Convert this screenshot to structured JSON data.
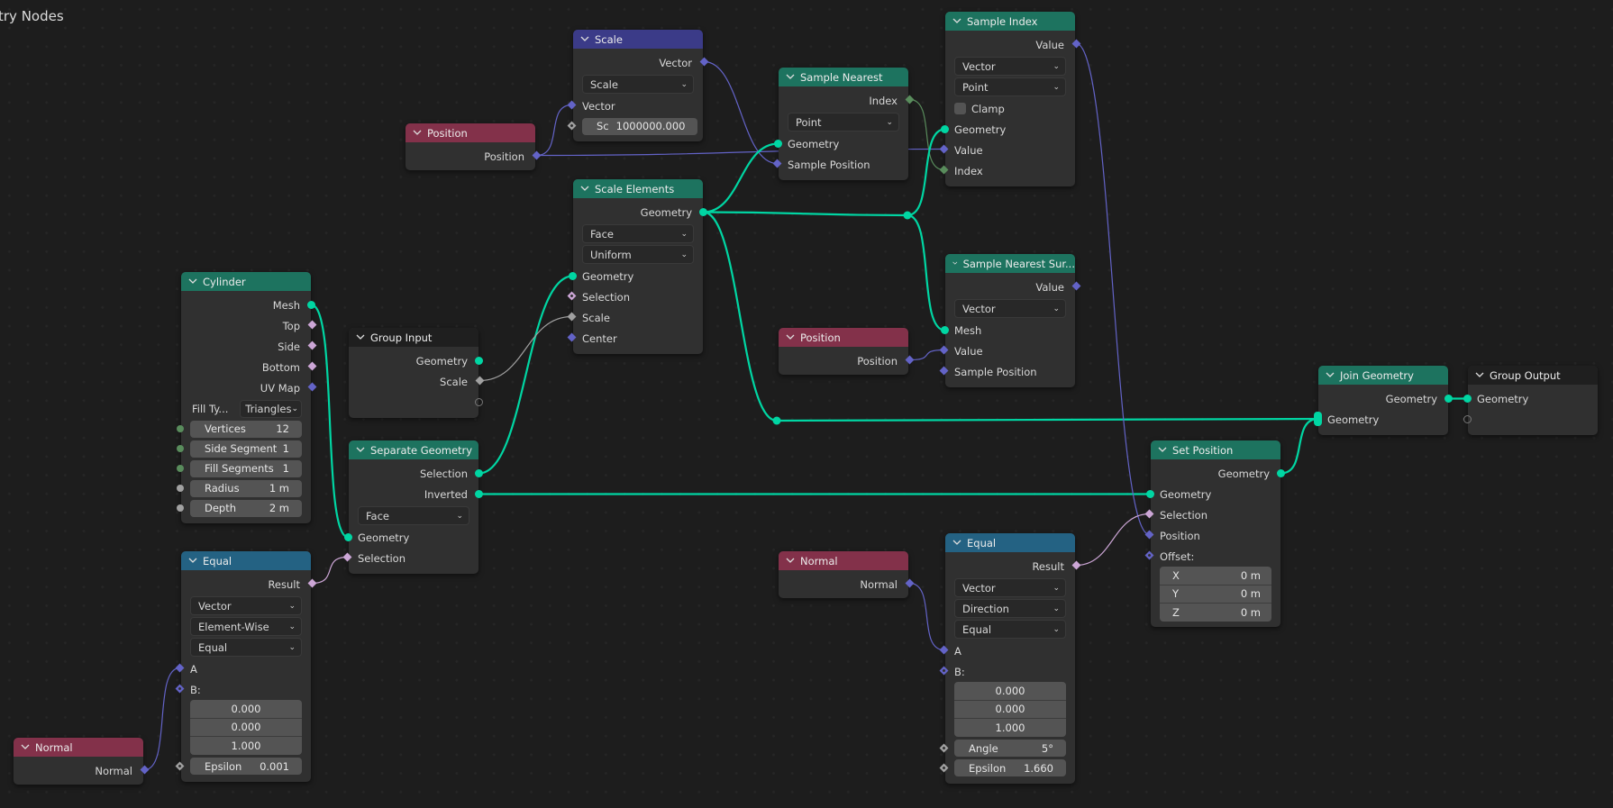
{
  "editor": {
    "title": "try Nodes"
  },
  "colors": {
    "background": "#1d1d1d",
    "node_body": "#303030",
    "geometry_header": "#1d735f",
    "input_header": "#83314a",
    "vector_header": "#3b3b88",
    "converter_header": "#246283",
    "geometry_socket": "#00d6a3",
    "vector_socket": "#6363c7",
    "boolean_socket": "#cca6d6",
    "float_socket": "#a1a1a1",
    "integer_socket": "#598c5c"
  },
  "nodes": {
    "scale": {
      "title": "Scale",
      "out_vector": "Vector",
      "operation": "Scale",
      "in_vector": "Vector",
      "scale_label": "Sc",
      "scale_value": "1000000.000"
    },
    "position_top": {
      "title": "Position",
      "out_position": "Position"
    },
    "sample_nearest": {
      "title": "Sample Nearest",
      "out_index": "Index",
      "domain": "Point",
      "in_geometry": "Geometry",
      "in_sample_position": "Sample Position"
    },
    "sample_index": {
      "title": "Sample Index",
      "out_value": "Value",
      "data_type": "Vector",
      "domain": "Point",
      "clamp_label": "Clamp",
      "clamp_checked": false,
      "in_geometry": "Geometry",
      "in_value": "Value",
      "in_index": "Index"
    },
    "scale_elements": {
      "title": "Scale Elements",
      "out_geometry": "Geometry",
      "domain": "Face",
      "scale_mode": "Uniform",
      "in_geometry": "Geometry",
      "in_selection": "Selection",
      "in_scale": "Scale",
      "in_center": "Center"
    },
    "sample_nearest_surface": {
      "title": "Sample Nearest Sur...",
      "out_value": "Value",
      "data_type": "Vector",
      "in_mesh": "Mesh",
      "in_value": "Value",
      "in_sample_position": "Sample Position"
    },
    "cylinder": {
      "title": "Cylinder",
      "outputs": [
        "Mesh",
        "Top",
        "Side",
        "Bottom",
        "UV Map"
      ],
      "fill_type_label": "Fill Ty...",
      "fill_type_value": "Triangles",
      "fields": [
        {
          "label": "Vertices",
          "value": "12"
        },
        {
          "label": "Side Segment",
          "value": "1"
        },
        {
          "label": "Fill Segments",
          "value": "1"
        },
        {
          "label": "Radius",
          "value": "1 m"
        },
        {
          "label": "Depth",
          "value": "2 m"
        }
      ]
    },
    "group_input": {
      "title": "Group Input",
      "out_geometry": "Geometry",
      "out_scale": "Scale"
    },
    "separate_geometry": {
      "title": "Separate Geometry",
      "out_selection": "Selection",
      "out_inverted": "Inverted",
      "domain": "Face",
      "in_geometry": "Geometry",
      "in_selection": "Selection"
    },
    "position_mid": {
      "title": "Position",
      "out_position": "Position"
    },
    "join_geometry": {
      "title": "Join Geometry",
      "out_geometry": "Geometry",
      "in_geometry": "Geometry"
    },
    "group_output": {
      "title": "Group Output",
      "in_geometry": "Geometry"
    },
    "set_position": {
      "title": "Set Position",
      "out_geometry": "Geometry",
      "in_geometry": "Geometry",
      "in_selection": "Selection",
      "in_position": "Position",
      "in_offset": "Offset:",
      "offset": [
        {
          "axis": "X",
          "value": "0 m"
        },
        {
          "axis": "Y",
          "value": "0 m"
        },
        {
          "axis": "Z",
          "value": "0 m"
        }
      ]
    },
    "equal_left": {
      "title": "Equal",
      "out_result": "Result",
      "data_type": "Vector",
      "mode": "Element-Wise",
      "operation": "Equal",
      "in_a": "A",
      "in_b": "B:",
      "b_values": [
        "0.000",
        "0.000",
        "1.000"
      ],
      "epsilon_label": "Epsilon",
      "epsilon_value": "0.001"
    },
    "equal_right": {
      "title": "Equal",
      "out_result": "Result",
      "data_type": "Vector",
      "mode": "Direction",
      "operation": "Equal",
      "in_a": "A",
      "in_b": "B:",
      "b_values": [
        "0.000",
        "0.000",
        "1.000"
      ],
      "angle_label": "Angle",
      "angle_value": "5°",
      "epsilon_label": "Epsilon",
      "epsilon_value": "1.660"
    },
    "normal_left": {
      "title": "Normal",
      "out_normal": "Normal"
    },
    "normal_right": {
      "title": "Normal",
      "out_normal": "Normal"
    }
  }
}
